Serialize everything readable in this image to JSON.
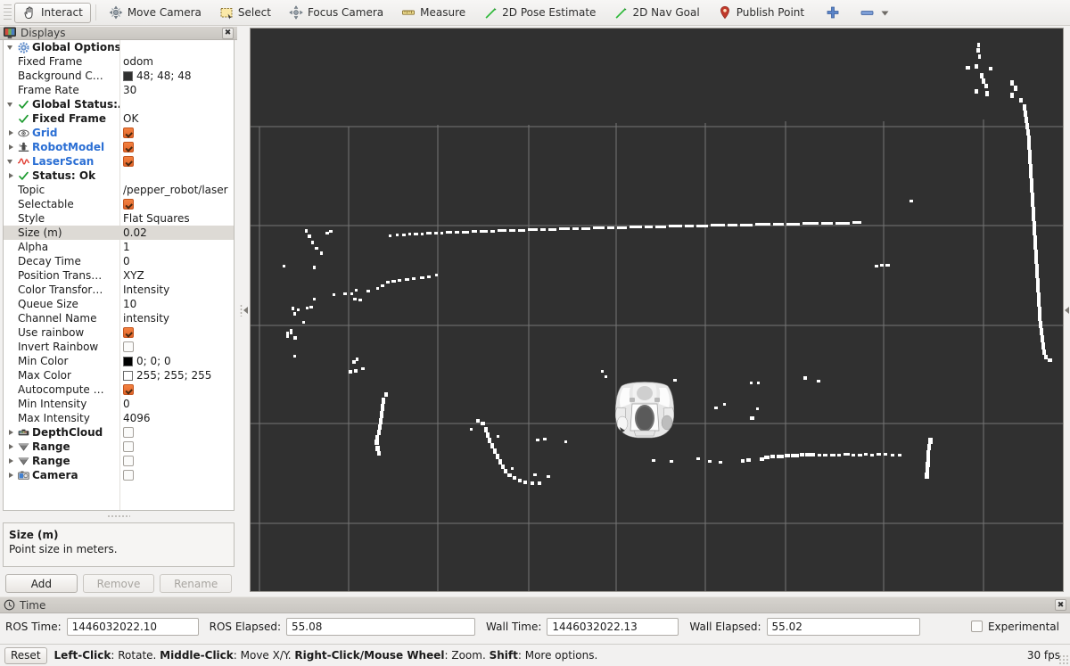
{
  "toolbar": {
    "items": [
      {
        "label": "Interact",
        "icon": "hand-cursor-icon",
        "active": true
      },
      {
        "label": "Move Camera",
        "icon": "move-camera-icon",
        "active": false
      },
      {
        "label": "Select",
        "icon": "select-rectangle-icon",
        "active": false
      },
      {
        "label": "Focus Camera",
        "icon": "focus-camera-icon",
        "active": false
      },
      {
        "label": "Measure",
        "icon": "measure-icon",
        "active": false
      },
      {
        "label": "2D Pose Estimate",
        "icon": "pose-arrow-icon",
        "active": false
      },
      {
        "label": "2D Nav Goal",
        "icon": "nav-goal-arrow-icon",
        "active": false
      },
      {
        "label": "Publish Point",
        "icon": "map-pin-icon",
        "active": false
      }
    ],
    "plus_icon": "plus-icon",
    "minus_icon": "minus-icon",
    "overflow_icon": "chevron-down-icon"
  },
  "displays": {
    "title": "Displays",
    "title_icon": "monitor-icon",
    "close_icon": "close-icon",
    "rows": [
      {
        "indent": 1,
        "arrow": "open",
        "icon": "gear-icon",
        "label": "Global Options",
        "style": "bold",
        "value": "",
        "value_type": "none"
      },
      {
        "indent": 2,
        "arrow": "none",
        "icon": "",
        "label": "Fixed Frame",
        "style": "plain",
        "value": "odom",
        "value_type": "text"
      },
      {
        "indent": 2,
        "arrow": "none",
        "icon": "",
        "label": "Background C…",
        "style": "plain",
        "value": "48; 48; 48",
        "value_type": "color",
        "color": "#303030"
      },
      {
        "indent": 2,
        "arrow": "none",
        "icon": "",
        "label": "Frame Rate",
        "style": "plain",
        "value": "30",
        "value_type": "text"
      },
      {
        "indent": 1,
        "arrow": "open",
        "icon": "check-ok-icon",
        "label": "Global Status:…",
        "style": "bold",
        "value": "",
        "value_type": "none"
      },
      {
        "indent": 2,
        "arrow": "none",
        "icon": "check-ok-icon",
        "label": "Fixed Frame",
        "style": "bold",
        "value": "OK",
        "value_type": "text"
      },
      {
        "indent": 1,
        "arrow": "closed",
        "icon": "grid-eye-icon",
        "label": "Grid",
        "style": "blue",
        "value": "",
        "value_type": "checkbox",
        "checked": true
      },
      {
        "indent": 1,
        "arrow": "closed",
        "icon": "robot-model-icon",
        "label": "RobotModel",
        "style": "blue",
        "value": "",
        "value_type": "checkbox",
        "checked": true
      },
      {
        "indent": 1,
        "arrow": "open",
        "icon": "laserscan-icon",
        "label": "LaserScan",
        "style": "red",
        "value": "",
        "value_type": "checkbox",
        "checked": true
      },
      {
        "indent": 2,
        "arrow": "closed",
        "icon": "check-ok-icon",
        "label": "Status: Ok",
        "style": "bold",
        "value": "",
        "value_type": "none"
      },
      {
        "indent": 3,
        "arrow": "none",
        "icon": "",
        "label": "Topic",
        "style": "plain",
        "value": "/pepper_robot/laser",
        "value_type": "text"
      },
      {
        "indent": 3,
        "arrow": "none",
        "icon": "",
        "label": "Selectable",
        "style": "plain",
        "value": "",
        "value_type": "checkbox",
        "checked": true
      },
      {
        "indent": 3,
        "arrow": "none",
        "icon": "",
        "label": "Style",
        "style": "plain",
        "value": "Flat Squares",
        "value_type": "text"
      },
      {
        "indent": 3,
        "arrow": "none",
        "icon": "",
        "label": "Size (m)",
        "style": "plain",
        "value": "0.02",
        "value_type": "text",
        "selected": true
      },
      {
        "indent": 3,
        "arrow": "none",
        "icon": "",
        "label": "Alpha",
        "style": "plain",
        "value": "1",
        "value_type": "text"
      },
      {
        "indent": 3,
        "arrow": "none",
        "icon": "",
        "label": "Decay Time",
        "style": "plain",
        "value": "0",
        "value_type": "text"
      },
      {
        "indent": 3,
        "arrow": "none",
        "icon": "",
        "label": "Position Trans…",
        "style": "plain",
        "value": "XYZ",
        "value_type": "text"
      },
      {
        "indent": 3,
        "arrow": "none",
        "icon": "",
        "label": "Color Transfor…",
        "style": "plain",
        "value": "Intensity",
        "value_type": "text"
      },
      {
        "indent": 3,
        "arrow": "none",
        "icon": "",
        "label": "Queue Size",
        "style": "plain",
        "value": "10",
        "value_type": "text"
      },
      {
        "indent": 3,
        "arrow": "none",
        "icon": "",
        "label": "Channel Name",
        "style": "plain",
        "value": "intensity",
        "value_type": "text"
      },
      {
        "indent": 3,
        "arrow": "none",
        "icon": "",
        "label": "Use rainbow",
        "style": "plain",
        "value": "",
        "value_type": "checkbox",
        "checked": true
      },
      {
        "indent": 3,
        "arrow": "none",
        "icon": "",
        "label": "Invert Rainbow",
        "style": "plain",
        "value": "",
        "value_type": "checkbox",
        "checked": false
      },
      {
        "indent": 3,
        "arrow": "none",
        "icon": "",
        "label": "Min Color",
        "style": "plain",
        "value": "0; 0; 0",
        "value_type": "color",
        "color": "#000000"
      },
      {
        "indent": 3,
        "arrow": "none",
        "icon": "",
        "label": "Max Color",
        "style": "plain",
        "value": "255; 255; 255",
        "value_type": "color",
        "color": "#ffffff"
      },
      {
        "indent": 3,
        "arrow": "none",
        "icon": "",
        "label": "Autocompute …",
        "style": "plain",
        "value": "",
        "value_type": "checkbox",
        "checked": true
      },
      {
        "indent": 3,
        "arrow": "none",
        "icon": "",
        "label": "Min Intensity",
        "style": "plain",
        "value": "0",
        "value_type": "text"
      },
      {
        "indent": 3,
        "arrow": "none",
        "icon": "",
        "label": "Max Intensity",
        "style": "plain",
        "value": "4096",
        "value_type": "text"
      },
      {
        "indent": 1,
        "arrow": "closed",
        "icon": "depthcloud-icon",
        "label": "DepthCloud",
        "style": "bold",
        "value": "",
        "value_type": "checkbox",
        "checked": false
      },
      {
        "indent": 1,
        "arrow": "closed",
        "icon": "range-cone-icon",
        "label": "Range",
        "style": "bold",
        "value": "",
        "value_type": "checkbox",
        "checked": false
      },
      {
        "indent": 1,
        "arrow": "closed",
        "icon": "range-cone-icon",
        "label": "Range",
        "style": "bold",
        "value": "",
        "value_type": "checkbox",
        "checked": false
      },
      {
        "indent": 1,
        "arrow": "closed",
        "icon": "camera-icon",
        "label": "Camera",
        "style": "bold",
        "value": "",
        "value_type": "checkbox",
        "checked": false
      }
    ],
    "help": {
      "title": "Size (m)",
      "description": "Point size in meters."
    },
    "buttons": [
      {
        "label": "Add",
        "enabled": true
      },
      {
        "label": "Remove",
        "enabled": false
      },
      {
        "label": "Rename",
        "enabled": false
      }
    ]
  },
  "viewport": {
    "background_color": "#303030",
    "grid_color": "#9a9a9a",
    "point_color": "#ffffff",
    "robot_name": "pepper-robot-model"
  },
  "time_panel": {
    "title": "Time",
    "title_icon": "clock-icon",
    "close_icon": "close-icon",
    "fields": [
      {
        "label": "ROS Time:",
        "value": "1446032022.10"
      },
      {
        "label": "ROS Elapsed:",
        "value": "55.08"
      },
      {
        "label": "Wall Time:",
        "value": "1446032022.13"
      },
      {
        "label": "Wall Elapsed:",
        "value": "55.02"
      }
    ],
    "experimental": {
      "label": "Experimental",
      "checked": false
    }
  },
  "status_bar": {
    "reset_label": "Reset",
    "hint_parts": [
      {
        "text": "Left-Click",
        "bold": true
      },
      {
        "text": ": Rotate.  ",
        "bold": false
      },
      {
        "text": "Middle-Click",
        "bold": true
      },
      {
        "text": ": Move X/Y.  ",
        "bold": false
      },
      {
        "text": "Right-Click/Mouse Wheel",
        "bold": true
      },
      {
        "text": ": Zoom.  ",
        "bold": false
      },
      {
        "text": "Shift",
        "bold": true
      },
      {
        "text": ": More options.",
        "bold": false
      }
    ],
    "fps": "30 fps"
  }
}
